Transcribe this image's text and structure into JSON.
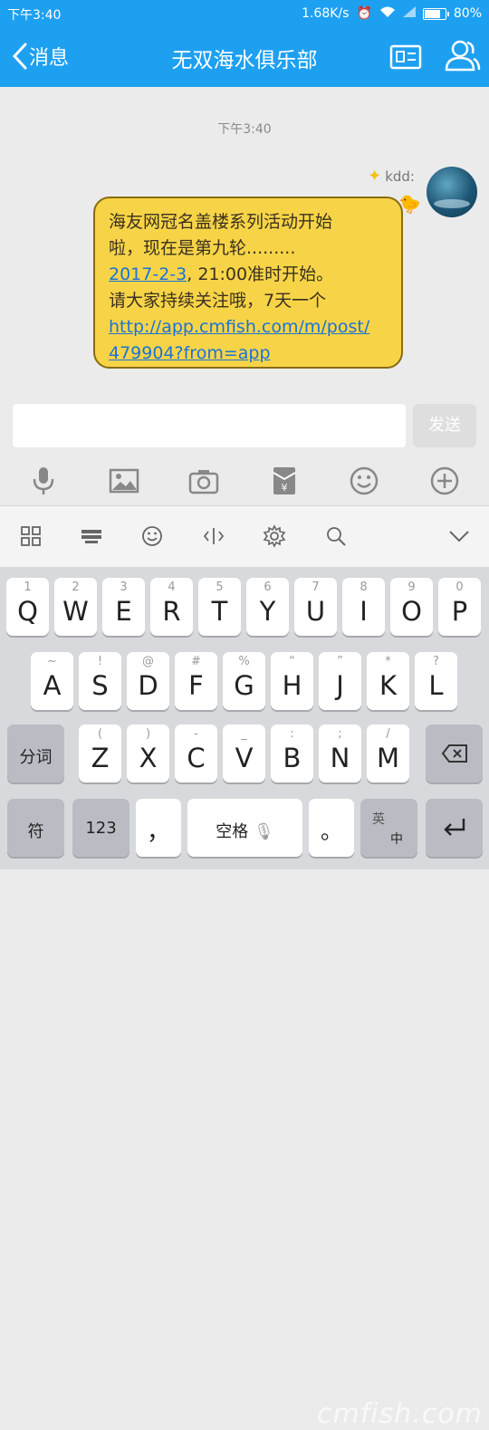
{
  "status_bar": {
    "time": "下午3:40",
    "network_speed": "1.68K/s",
    "battery": "80%"
  },
  "nav": {
    "back_label": "消息",
    "title": "无双海水俱乐部"
  },
  "chat": {
    "timestamp": "下午3:40",
    "message": {
      "sender": "kdd:",
      "line1": "海友网冠名盖楼系列活动开始",
      "line2": "啦，现在是第九轮.........",
      "line3_link": "2017-2-3",
      "line3_rest": ", 21:00准时开始。",
      "line4": "请大家持续关注哦，7天一个",
      "url_line1": "http://app.cmfish.com/m/post/",
      "url_line2": "479904?from=app"
    }
  },
  "composer": {
    "send_label": "发送"
  },
  "keyboard": {
    "row1": [
      {
        "ch": "Q",
        "hint": "1"
      },
      {
        "ch": "W",
        "hint": "2"
      },
      {
        "ch": "E",
        "hint": "3"
      },
      {
        "ch": "R",
        "hint": "4"
      },
      {
        "ch": "T",
        "hint": "5"
      },
      {
        "ch": "Y",
        "hint": "6"
      },
      {
        "ch": "U",
        "hint": "7"
      },
      {
        "ch": "I",
        "hint": "8"
      },
      {
        "ch": "O",
        "hint": "9"
      },
      {
        "ch": "P",
        "hint": "0"
      }
    ],
    "row2": [
      {
        "ch": "A",
        "hint": "~"
      },
      {
        "ch": "S",
        "hint": "!"
      },
      {
        "ch": "D",
        "hint": "@"
      },
      {
        "ch": "F",
        "hint": "#"
      },
      {
        "ch": "G",
        "hint": "%"
      },
      {
        "ch": "H",
        "hint": "“"
      },
      {
        "ch": "J",
        "hint": "”"
      },
      {
        "ch": "K",
        "hint": "*"
      },
      {
        "ch": "L",
        "hint": "?"
      }
    ],
    "row3": [
      {
        "ch": "Z",
        "hint": "("
      },
      {
        "ch": "X",
        "hint": ")"
      },
      {
        "ch": "C",
        "hint": "-"
      },
      {
        "ch": "V",
        "hint": "_"
      },
      {
        "ch": "B",
        "hint": ":"
      },
      {
        "ch": "N",
        "hint": ";"
      },
      {
        "ch": "M",
        "hint": "/"
      }
    ],
    "fenci_label": "分词",
    "symbol_label": "符",
    "num_label": "123",
    "comma_label": "，",
    "space_label": "空格",
    "period_label": "。",
    "lang_top": "英",
    "lang_bottom": "中"
  },
  "watermark": "cmfish.com",
  "colors": {
    "brand_blue": "#1ea0f1",
    "bubble_yellow": "#f7d447",
    "link_blue": "#1a73d9"
  }
}
